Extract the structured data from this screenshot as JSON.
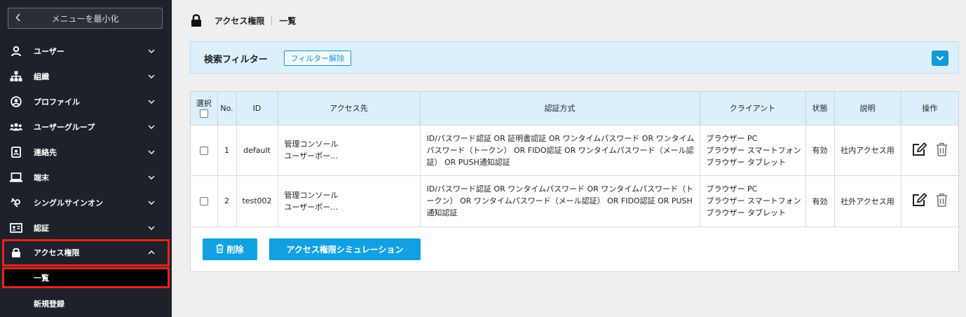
{
  "sidebar": {
    "minimize_label": "メニューを最小化",
    "items": [
      {
        "label": "ユーザー",
        "icon": "user-icon"
      },
      {
        "label": "組織",
        "icon": "org-chart-icon"
      },
      {
        "label": "プロファイル",
        "icon": "profile-circle-icon"
      },
      {
        "label": "ユーザーグループ",
        "icon": "users-group-icon"
      },
      {
        "label": "連絡先",
        "icon": "contact-book-icon"
      },
      {
        "label": "端末",
        "icon": "laptop-icon"
      },
      {
        "label": "シングルサインオン",
        "icon": "sso-icon"
      },
      {
        "label": "認証",
        "icon": "id-card-icon"
      },
      {
        "label": "アクセス権限",
        "icon": "lock-icon"
      }
    ],
    "subitems": [
      {
        "label": "一覧"
      },
      {
        "label": "新規登録"
      }
    ]
  },
  "header": {
    "crumb1": "アクセス権限",
    "crumb2": "一覧"
  },
  "filter": {
    "title": "検索フィルター",
    "clear_label": "フィルター解除"
  },
  "table": {
    "headers": {
      "select": "選択",
      "no": "No.",
      "id": "ID",
      "dest": "アクセス先",
      "auth": "認証方式",
      "client": "クライアント",
      "status": "状態",
      "desc": "説明",
      "ops": "操作"
    },
    "rows": [
      {
        "no": "1",
        "id": "default",
        "dest1": "管理コンソール",
        "dest2": "ユーザーポー…",
        "auth1": "ID/パスワード認証 OR 証明書認証 OR ワンタイムパスワード OR ワンタイム",
        "auth2": "パスワード（トークン） OR FIDO認証 OR ワンタイムパスワード（メール認",
        "auth3": "証） OR PUSH通知認証",
        "client1": "ブラウザー PC",
        "client2": "ブラウザー スマートフォン",
        "client3": "ブラウザー タブレット",
        "status": "有効",
        "desc": "社内アクセス用"
      },
      {
        "no": "2",
        "id": "test002",
        "dest1": "管理コンソール",
        "dest2": "ユーザーポー…",
        "auth1": "ID/パスワード認証 OR ワンタイムパスワード OR ワンタイムパスワード（ト",
        "auth2": "ークン） OR ワンタイムパスワード（メール認証） OR FIDO認証 OR PUSH",
        "auth3": "通知認証",
        "client1": "ブラウザー PC",
        "client2": "ブラウザー スマートフォン",
        "client3": "ブラウザー タブレット",
        "status": "有効",
        "desc": "社外アクセス用"
      }
    ]
  },
  "actions": {
    "delete_label": "削除",
    "simulate_label": "アクセス権限シミュレーション"
  },
  "colors": {
    "sidebar_bg": "#1d2129",
    "accent": "#11a1e3",
    "highlight": "#e3241f",
    "header_bg": "#dbf0fa"
  }
}
